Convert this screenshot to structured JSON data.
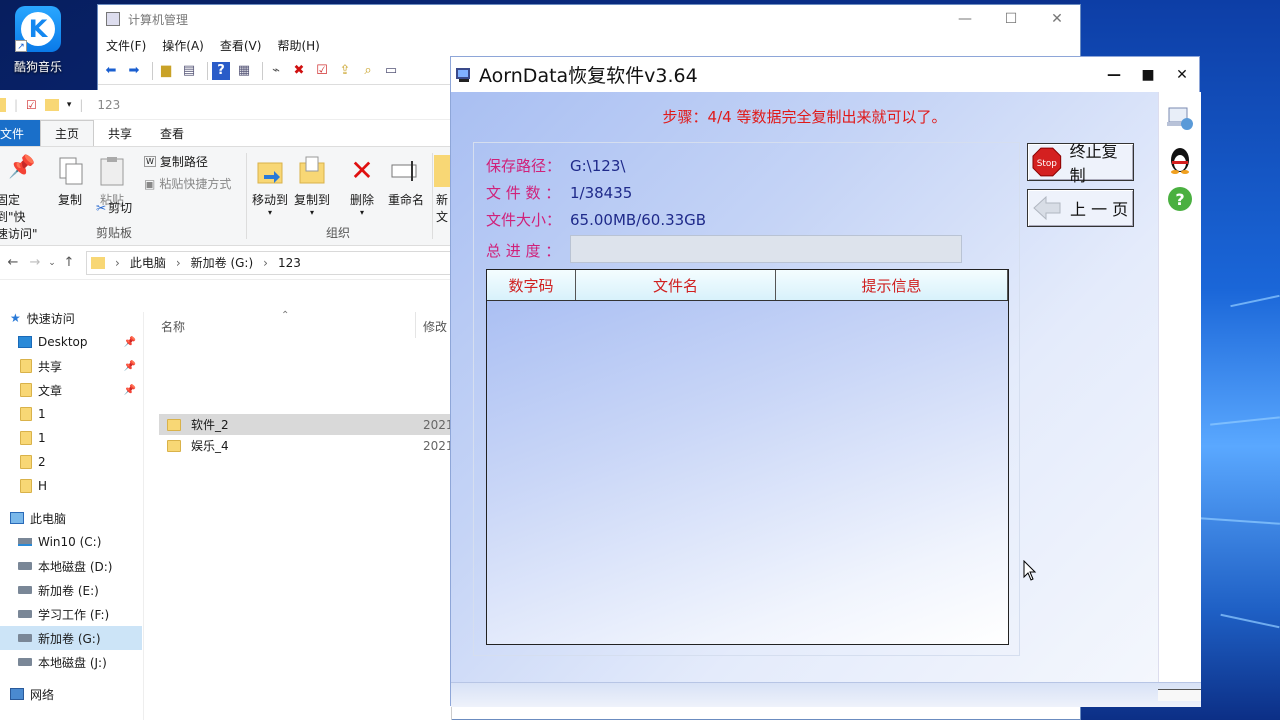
{
  "desktop": {
    "icon_label": "酷狗音乐"
  },
  "mgmt": {
    "title": "计算机管理",
    "menu": [
      "文件(F)",
      "操作(A)",
      "查看(V)",
      "帮助(H)"
    ]
  },
  "explorer": {
    "qat_path": "123",
    "tabs": {
      "file": "文件",
      "home": "主页",
      "share": "共享",
      "view": "查看"
    },
    "ribbon": {
      "pin_line1": "固定到\"快",
      "pin_line2": "速访问\"",
      "copy": "复制",
      "paste": "粘贴",
      "copy_path": "复制路径",
      "paste_shortcut": "粘贴快捷方式",
      "cut": "剪切",
      "clipboard_group": "剪贴板",
      "move_to": "移动到",
      "copy_to": "复制到",
      "delete": "删除",
      "rename": "重命名",
      "new_line1": "新",
      "new_line2": "文",
      "organize_group": "组织"
    },
    "address": {
      "pc": "此电脑",
      "drive": "新加卷 (G:)",
      "folder": "123"
    },
    "columns": {
      "name": "名称",
      "modified": "修改"
    },
    "files": [
      {
        "name": "软件_2",
        "date": "2021"
      },
      {
        "name": "娱乐_4",
        "date": "2021"
      }
    ],
    "nav": {
      "quick_access": "快速访问",
      "quick_items": [
        "Desktop",
        "共享",
        "文章",
        "1",
        "1",
        "2",
        "H"
      ],
      "this_pc": "此电脑",
      "drives": [
        "Win10 (C:)",
        "本地磁盘 (D:)",
        "新加卷 (E:)",
        "学习工作 (F:)",
        "新加卷 (G:)",
        "本地磁盘 (J:)"
      ],
      "network": "网络"
    }
  },
  "aorn": {
    "title": "AornData恢复软件v3.64",
    "step_message": "步骤：4/4 等数据完全复制出来就可以了。",
    "save_path_label": "保存路径：",
    "save_path": "G:\\123\\",
    "file_count_label": "文 件 数 ：",
    "file_count": "1/38435",
    "file_size_label": "文件大小：",
    "file_size": "65.00MB/60.33GB",
    "progress_label": "总 进 度 ：",
    "progress_fraction": 0.0,
    "list_columns": [
      "数字码",
      "文件名",
      "提示信息"
    ],
    "stop_button": "终止复制",
    "prev_button": "上 一 页",
    "stop_icon_text": "Stop"
  },
  "colors": {
    "step_red": "#e01a1a",
    "label_magenta": "#d0217a",
    "value_blue": "#1f2a8a",
    "file_tab_blue": "#1a6fc9"
  }
}
